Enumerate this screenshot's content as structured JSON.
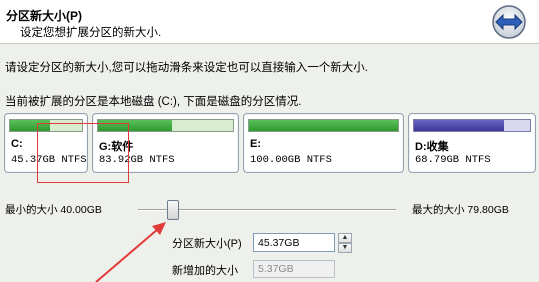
{
  "header": {
    "title": "分区新大小(P)",
    "subtitle": "设定您想扩展分区的新大小."
  },
  "content": {
    "instruction": "请设定分区的新大小,您可以拖动滑条来设定也可以直接输入一个新大小.",
    "status": "当前被扩展的分区是本地磁盘 (C:), 下面是磁盘的分区情况."
  },
  "partitions": [
    {
      "label": "C:",
      "size": "45.37GB NTFS",
      "used_fraction": 0.55,
      "color": "#3aa83a"
    },
    {
      "label": "G:软件",
      "size": "83.92GB NTFS",
      "used_fraction": 0.55,
      "color": "#3aa83a"
    },
    {
      "label": "E:",
      "size": "100.00GB NTFS",
      "used_fraction": 1.0,
      "color": "#3aa83a"
    },
    {
      "label": "D:收集",
      "size": "68.79GB NTFS",
      "used_fraction": 0.78,
      "color": "#4a44b0"
    }
  ],
  "slider": {
    "min_label": "最小的大小 40.00GB",
    "max_label": "最大的大小 79.80GB",
    "min_value": 40.0,
    "max_value": 79.8,
    "current_value": 45.37
  },
  "fields": {
    "new_size_label": "分区新大小(P)",
    "new_size_value": "45.37GB",
    "added_label": "新增加的大小",
    "added_value": "5.37GB"
  },
  "colors": {
    "accent": "#e23b3b",
    "green_fill": "#3aa83a",
    "purple_fill": "#4a44b0"
  }
}
